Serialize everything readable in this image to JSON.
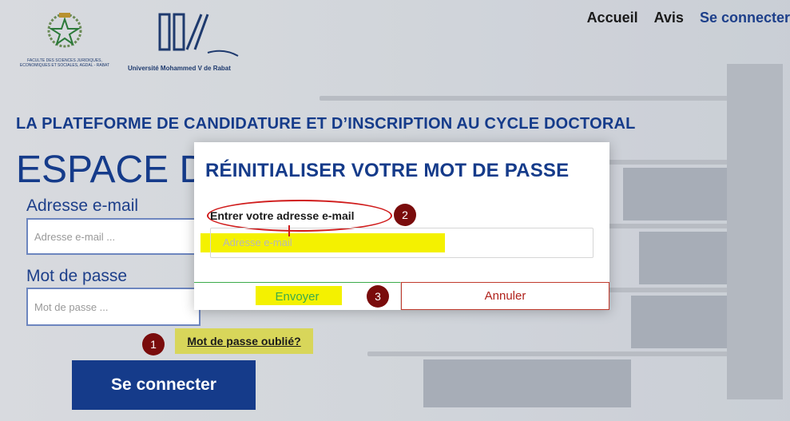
{
  "header": {
    "logo_faculty_caption": "FACULTE DES SCIENCES JURIDIQUES, ECONOMIQUES ET SOCIALES, AGDAL - RABAT",
    "logo_university_caption": "Université Mohammed V de Rabat",
    "nav": [
      {
        "label": "Accueil"
      },
      {
        "label": "Avis"
      },
      {
        "label": "Se connecter"
      }
    ]
  },
  "page": {
    "headline": "LA PLATEFORME DE CANDIDATURE ET D’INSCRIPTION AU CYCLE DOCTORAL",
    "espace_title": "ESPACE D",
    "email_label": "Adresse e-mail",
    "email_placeholder": "Adresse e-mail ...",
    "password_label": "Mot de passe",
    "password_placeholder": "Mot de passe ...",
    "forgot_link": "Mot de passe oublié?",
    "login_button": "Se connecter"
  },
  "modal": {
    "title": "RÉINITIALISER VOTRE MOT DE PASSE",
    "field_label": "Entrer votre adresse e-mail",
    "field_placeholder": "Adresse e-mail",
    "send_button": "Envoyer",
    "cancel_button": "Annuler"
  },
  "markers": [
    "1",
    "2",
    "3"
  ],
  "colors": {
    "brand_blue": "#153b8a",
    "marker_red": "#7a0c0c",
    "highlight_yellow": "#f4f100",
    "send_green": "#3cab4a",
    "cancel_red": "#b0221c"
  }
}
